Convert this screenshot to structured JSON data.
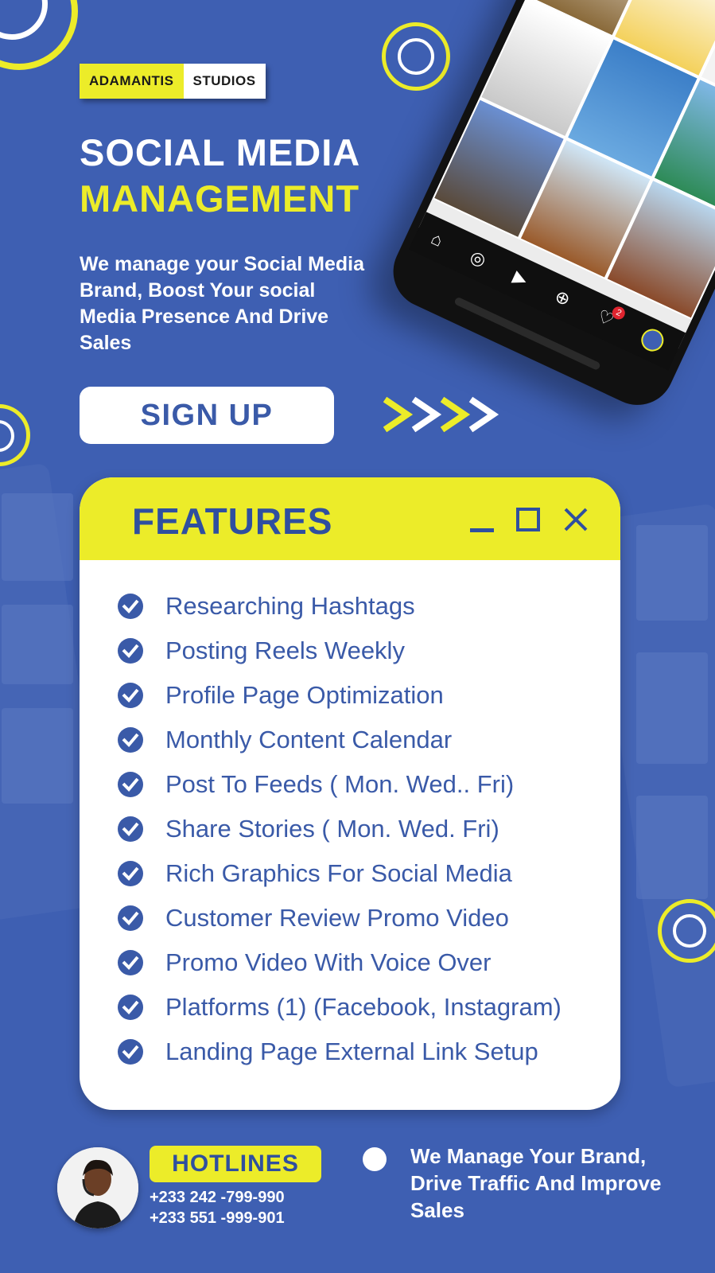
{
  "colors": {
    "background": "#3e5fb2",
    "accent_yellow": "#ecec29",
    "card_text": "#3a5aa8",
    "white": "#ffffff"
  },
  "logo": {
    "part1": "ADAMANTIS",
    "part2": "STUDIOS"
  },
  "hero": {
    "title_line1": "SOCIAL MEDIA",
    "title_line2": "MANAGEMENT",
    "tagline": "We manage your Social Media Brand, Boost Your social Media Presence And Drive Sales"
  },
  "signup": {
    "label": "SIGN UP",
    "arrow_icon": "chevron-arrows-icon"
  },
  "phone_mockup": {
    "tiles": [
      "prime-lands-ad",
      "strength-durability-ad",
      "your-home-together-ad",
      "connect-with-us-ad",
      "house-ad",
      "villa-ad",
      "modern-building-ad",
      "curved-building-ad",
      "house-ad-2"
    ],
    "nav_icons": [
      "home-icon",
      "explore-icon",
      "reels-icon",
      "add-icon",
      "activity-icon",
      "profile-avatar-icon"
    ],
    "notification_count": "2"
  },
  "features": {
    "title": "FEATURES",
    "window_controls": [
      "minimize-icon",
      "maximize-icon",
      "close-icon"
    ],
    "items": [
      "Researching Hashtags",
      "Posting Reels Weekly",
      "Profile Page Optimization",
      "Monthly Content Calendar",
      "Post To Feeds ( Mon. Wed.. Fri)",
      "Share Stories ( Mon. Wed. Fri)",
      "Rich Graphics For Social Media",
      "Customer Review Promo Video",
      "Promo Video With Voice Over",
      "Platforms (1) (Facebook, Instagram)",
      "Landing Page External Link Setup"
    ]
  },
  "footer": {
    "hotlines_label": "HOTLINES",
    "phones": [
      "+233 242 -799-990",
      "+233 551 -999-901"
    ],
    "tagline": "We Manage Your Brand, Drive Traffic And Improve Sales"
  }
}
